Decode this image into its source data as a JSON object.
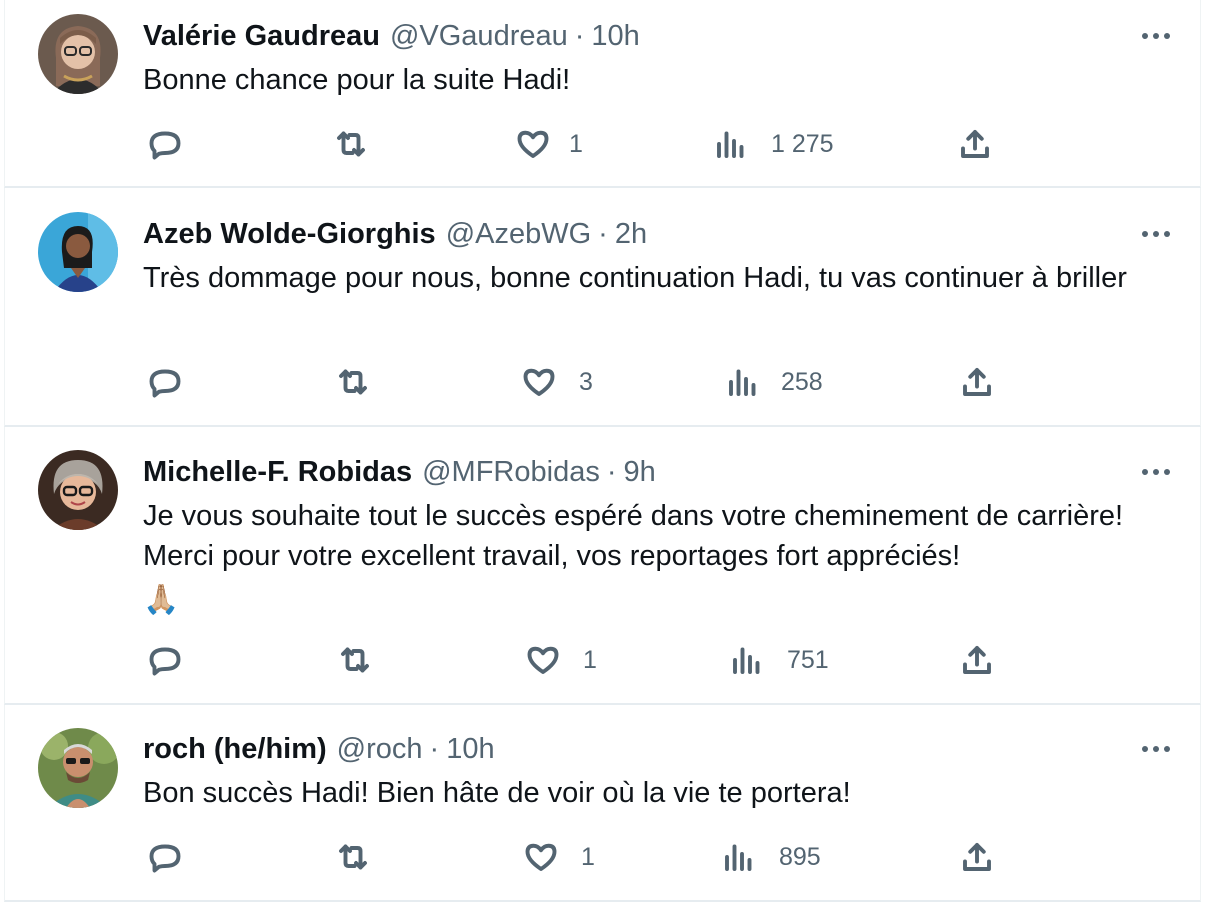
{
  "tweets": [
    {
      "name": "Valérie Gaudreau",
      "handle": "@VGaudreau",
      "separator": "·",
      "time": "10h",
      "text": "Bonne chance pour la suite Hadi!",
      "likes": "1",
      "views": "1 275"
    },
    {
      "name": "Azeb Wolde-Giorghis",
      "handle": "@AzebWG",
      "separator": "·",
      "time": "2h",
      "text": "Très dommage pour nous, bonne continuation Hadi, tu vas continuer à briller",
      "likes": "3",
      "views": "258"
    },
    {
      "name": "Michelle-F. Robidas",
      "handle": "@MFRobidas",
      "separator": "·",
      "time": "9h",
      "text": "Je vous souhaite tout le succès espéré dans votre cheminement de carrière! Merci pour votre excellent travail, vos reportages fort appréciés!",
      "emoji": "🙏🏼",
      "likes": "1",
      "views": "751"
    },
    {
      "name": "roch (he/him)",
      "handle": "@roch",
      "separator": "·",
      "time": "10h",
      "text": "Bon succès Hadi! Bien hâte de voir où la vie te portera!",
      "likes": "1",
      "views": "895"
    }
  ],
  "icons": {
    "reply": "reply-icon",
    "retweet": "retweet-icon",
    "like": "heart-icon",
    "views": "views-chart-icon",
    "share": "share-icon",
    "more": "more-options-icon"
  },
  "colors": {
    "text": "#0f1419",
    "secondary": "#536471",
    "divider": "#e6ecf0"
  }
}
